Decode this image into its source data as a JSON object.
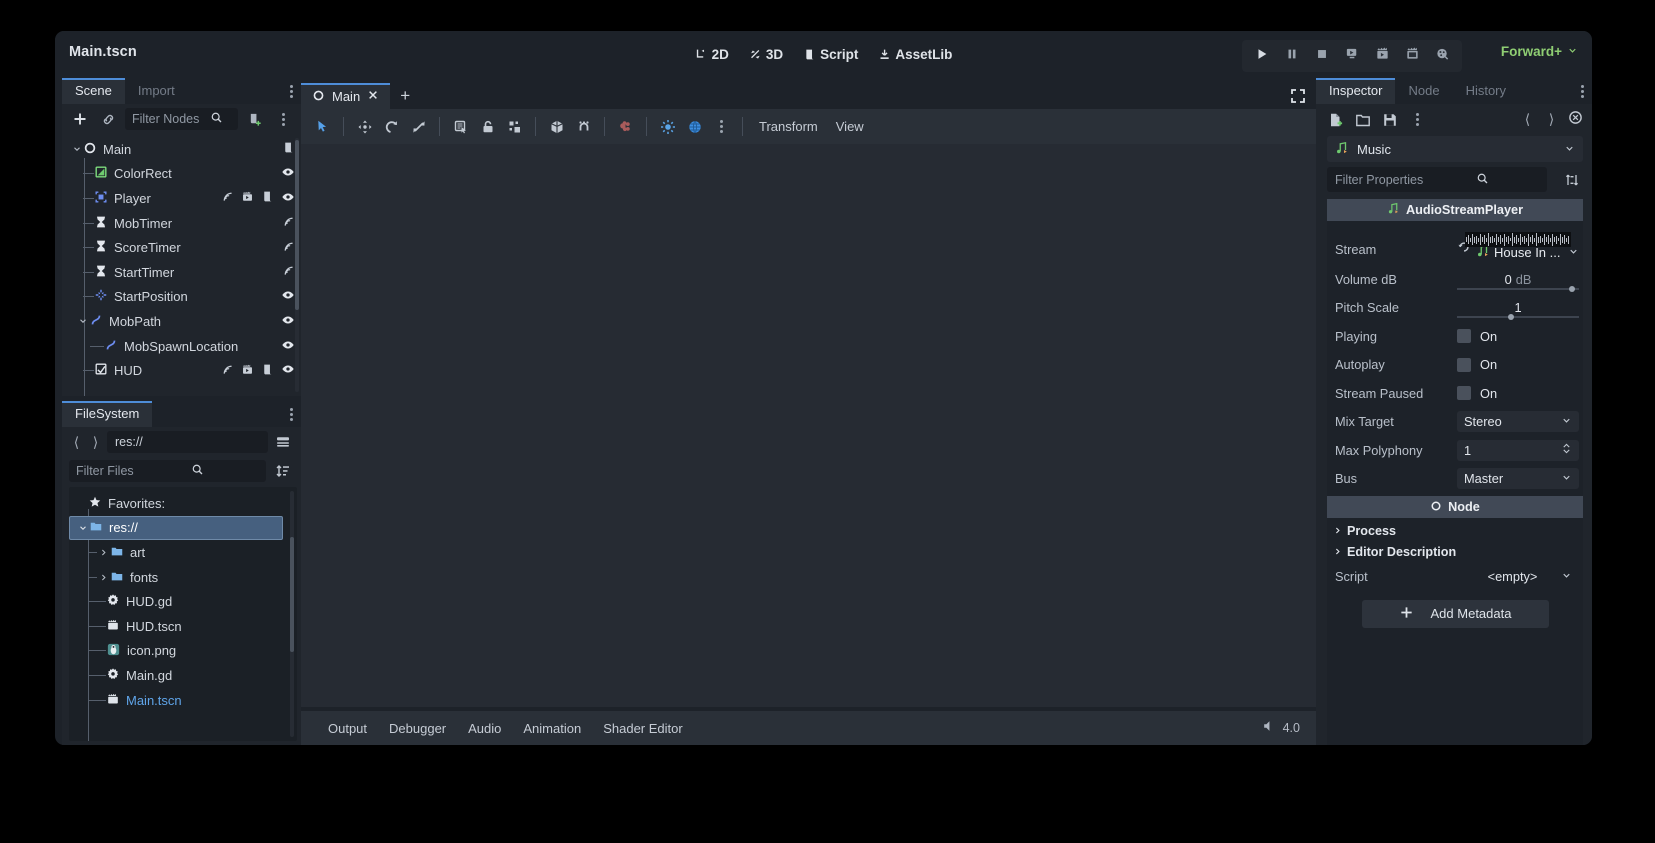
{
  "window": {
    "title": "Main.tscn"
  },
  "main_menus": [
    {
      "label": "2D",
      "icon": "2d-icon"
    },
    {
      "label": "3D",
      "icon": "3d-icon"
    },
    {
      "label": "Script",
      "icon": "script-icon"
    },
    {
      "label": "AssetLib",
      "icon": "assetlib-icon"
    }
  ],
  "run_toolbar": [
    {
      "name": "play-button",
      "icon": "play-icon"
    },
    {
      "name": "pause-button",
      "icon": "pause-icon"
    },
    {
      "name": "stop-button",
      "icon": "stop-icon"
    },
    {
      "name": "run-current-scene-button",
      "icon": "play-scene-icon"
    },
    {
      "name": "movie-writer-button",
      "icon": "film-play-icon"
    },
    {
      "name": "run-specific-scene-button",
      "icon": "film-icon"
    },
    {
      "name": "remote-debug-button",
      "icon": "network-profiler-icon"
    }
  ],
  "renderer": {
    "label": "Forward+"
  },
  "scene_dock": {
    "tabs": [
      {
        "label": "Scene",
        "active": true
      },
      {
        "label": "Import",
        "active": false
      }
    ],
    "toolbar": {
      "add_label": "+",
      "filter_placeholder": "Filter Nodes"
    },
    "tree": [
      {
        "label": "Main",
        "depth": 0,
        "icon": "node2d-icon",
        "expand": "down",
        "icons": [
          "script-icon"
        ]
      },
      {
        "label": "ColorRect",
        "depth": 1,
        "icon": "colorrect-icon",
        "expand": "none",
        "icons": [
          "visibility-icon"
        ]
      },
      {
        "label": "Player",
        "depth": 1,
        "icon": "area2d-icon",
        "expand": "none",
        "icons": [
          "signal-icon",
          "animation-icon",
          "script-icon",
          "visibility-icon"
        ]
      },
      {
        "label": "MobTimer",
        "depth": 1,
        "icon": "timer-icon",
        "expand": "none",
        "icons": [
          "signal-icon"
        ]
      },
      {
        "label": "ScoreTimer",
        "depth": 1,
        "icon": "timer-icon",
        "expand": "none",
        "icons": [
          "signal-icon"
        ]
      },
      {
        "label": "StartTimer",
        "depth": 1,
        "icon": "timer-icon",
        "expand": "none",
        "icons": [
          "signal-icon"
        ]
      },
      {
        "label": "StartPosition",
        "depth": 1,
        "icon": "marker2d-icon",
        "expand": "none",
        "icons": [
          "visibility-icon"
        ]
      },
      {
        "label": "MobPath",
        "depth": 1,
        "icon": "path2d-icon",
        "expand": "down",
        "icons": [
          "visibility-icon"
        ]
      },
      {
        "label": "MobSpawnLocation",
        "depth": 2,
        "icon": "path2d-icon",
        "expand": "none",
        "icons": [
          "visibility-icon"
        ]
      },
      {
        "label": "HUD",
        "depth": 1,
        "icon": "canvaslayer-icon",
        "expand": "none",
        "icons": [
          "signal-icon",
          "animation-icon",
          "script-icon",
          "visibility-icon"
        ]
      }
    ]
  },
  "filesystem_dock": {
    "tabs": [
      {
        "label": "FileSystem",
        "active": true
      }
    ],
    "path": "res://",
    "filter_placeholder": "Filter Files",
    "items": [
      {
        "label": "Favorites:",
        "depth": 0,
        "icon": "star-icon",
        "expand": "none",
        "selected": false,
        "open": false
      },
      {
        "label": "res://",
        "depth": 0,
        "icon": "folder-icon",
        "expand": "down",
        "selected": true,
        "open": false
      },
      {
        "label": "art",
        "depth": 1,
        "icon": "folder-icon",
        "expand": "right",
        "selected": false,
        "open": false
      },
      {
        "label": "fonts",
        "depth": 1,
        "icon": "folder-icon",
        "expand": "right",
        "selected": false,
        "open": false
      },
      {
        "label": "HUD.gd",
        "depth": 1,
        "icon": "gdscript-icon",
        "expand": "none",
        "selected": false,
        "open": false
      },
      {
        "label": "HUD.tscn",
        "depth": 1,
        "icon": "packedscene-icon",
        "expand": "none",
        "selected": false,
        "open": false
      },
      {
        "label": "icon.png",
        "depth": 1,
        "icon": "image-icon",
        "expand": "none",
        "selected": false,
        "open": false
      },
      {
        "label": "Main.gd",
        "depth": 1,
        "icon": "gdscript-icon",
        "expand": "none",
        "selected": false,
        "open": false
      },
      {
        "label": "Main.tscn",
        "depth": 1,
        "icon": "packedscene-icon",
        "expand": "none",
        "selected": false,
        "open": true
      }
    ]
  },
  "scene_tabs": {
    "open_tab": "Main",
    "add_label": "+"
  },
  "viewport_toolbar": {
    "tools": [
      {
        "name": "select-mode-button",
        "icon": "cursor-arrow-icon",
        "active": true
      },
      {
        "name": "move-mode-button",
        "icon": "move-icon",
        "active": false
      },
      {
        "name": "rotate-mode-button",
        "icon": "rotate-icon",
        "active": false
      },
      {
        "name": "scale-mode-button",
        "icon": "scale-icon",
        "active": false
      },
      {
        "name": "list-select-button",
        "icon": "list-select-icon",
        "active": false
      },
      {
        "name": "lock-button",
        "icon": "lock-icon",
        "active": false
      },
      {
        "name": "group-button",
        "icon": "group-icon",
        "active": false
      },
      {
        "name": "ruler-mode-button",
        "icon": "box-icon",
        "active": false
      },
      {
        "name": "snap-mode-button",
        "icon": "magnet-snap-icon",
        "active": false
      },
      {
        "name": "skeleton-options-button",
        "icon": "bone-icon",
        "active": false
      },
      {
        "name": "preview-sun-button",
        "icon": "sun-icon",
        "active": false
      },
      {
        "name": "preview-environment-button",
        "icon": "globe-icon",
        "active": false
      },
      {
        "name": "viewport-more-options-button",
        "icon": "vertical-dots-icon",
        "active": false
      }
    ],
    "menus": [
      "Transform",
      "View"
    ]
  },
  "bottom_dock": {
    "tabs": [
      "Output",
      "Debugger",
      "Audio",
      "Animation",
      "Shader Editor"
    ],
    "version": "4.0"
  },
  "inspector": {
    "tabs": [
      {
        "label": "Inspector",
        "active": true
      },
      {
        "label": "Node",
        "active": false
      },
      {
        "label": "History",
        "active": false
      }
    ],
    "toolbar": [
      {
        "name": "new-resource-button",
        "icon": "new-file-icon"
      },
      {
        "name": "load-resource-button",
        "icon": "folder-open-icon"
      },
      {
        "name": "save-resource-button",
        "icon": "save-icon"
      },
      {
        "name": "inspector-more-button",
        "icon": "vertical-dots-icon"
      }
    ],
    "object_name": "Music",
    "filter_placeholder": "Filter Properties",
    "class_header": "AudioStreamPlayer",
    "properties": [
      {
        "name": "Stream",
        "type": "resource",
        "value": "House In ...",
        "has_revert": true
      },
      {
        "name": "Volume dB",
        "type": "number",
        "value": "0",
        "unit": "dB",
        "slider_pos": 0.9
      },
      {
        "name": "Pitch Scale",
        "type": "number",
        "value": "1",
        "unit": "",
        "slider_pos": 0.42
      },
      {
        "name": "Playing",
        "type": "checkbox",
        "value": "On",
        "checked": false
      },
      {
        "name": "Autoplay",
        "type": "checkbox",
        "value": "On",
        "checked": false
      },
      {
        "name": "Stream Paused",
        "type": "checkbox",
        "value": "On",
        "checked": false
      },
      {
        "name": "Mix Target",
        "type": "enum",
        "value": "Stereo"
      },
      {
        "name": "Max Polyphony",
        "type": "spin",
        "value": "1"
      },
      {
        "name": "Bus",
        "type": "enum",
        "value": "Master"
      }
    ],
    "node_section": "Node",
    "sub_sections": [
      "Process",
      "Editor Description"
    ],
    "script_row": {
      "name": "Script",
      "value": "<empty>"
    },
    "add_metadata": "Add Metadata"
  },
  "colors": {
    "accent": "#4e8dd8",
    "selection": "#46607f",
    "renderer_text": "#8fce73",
    "open_scene_text": "#5fa4e8"
  }
}
